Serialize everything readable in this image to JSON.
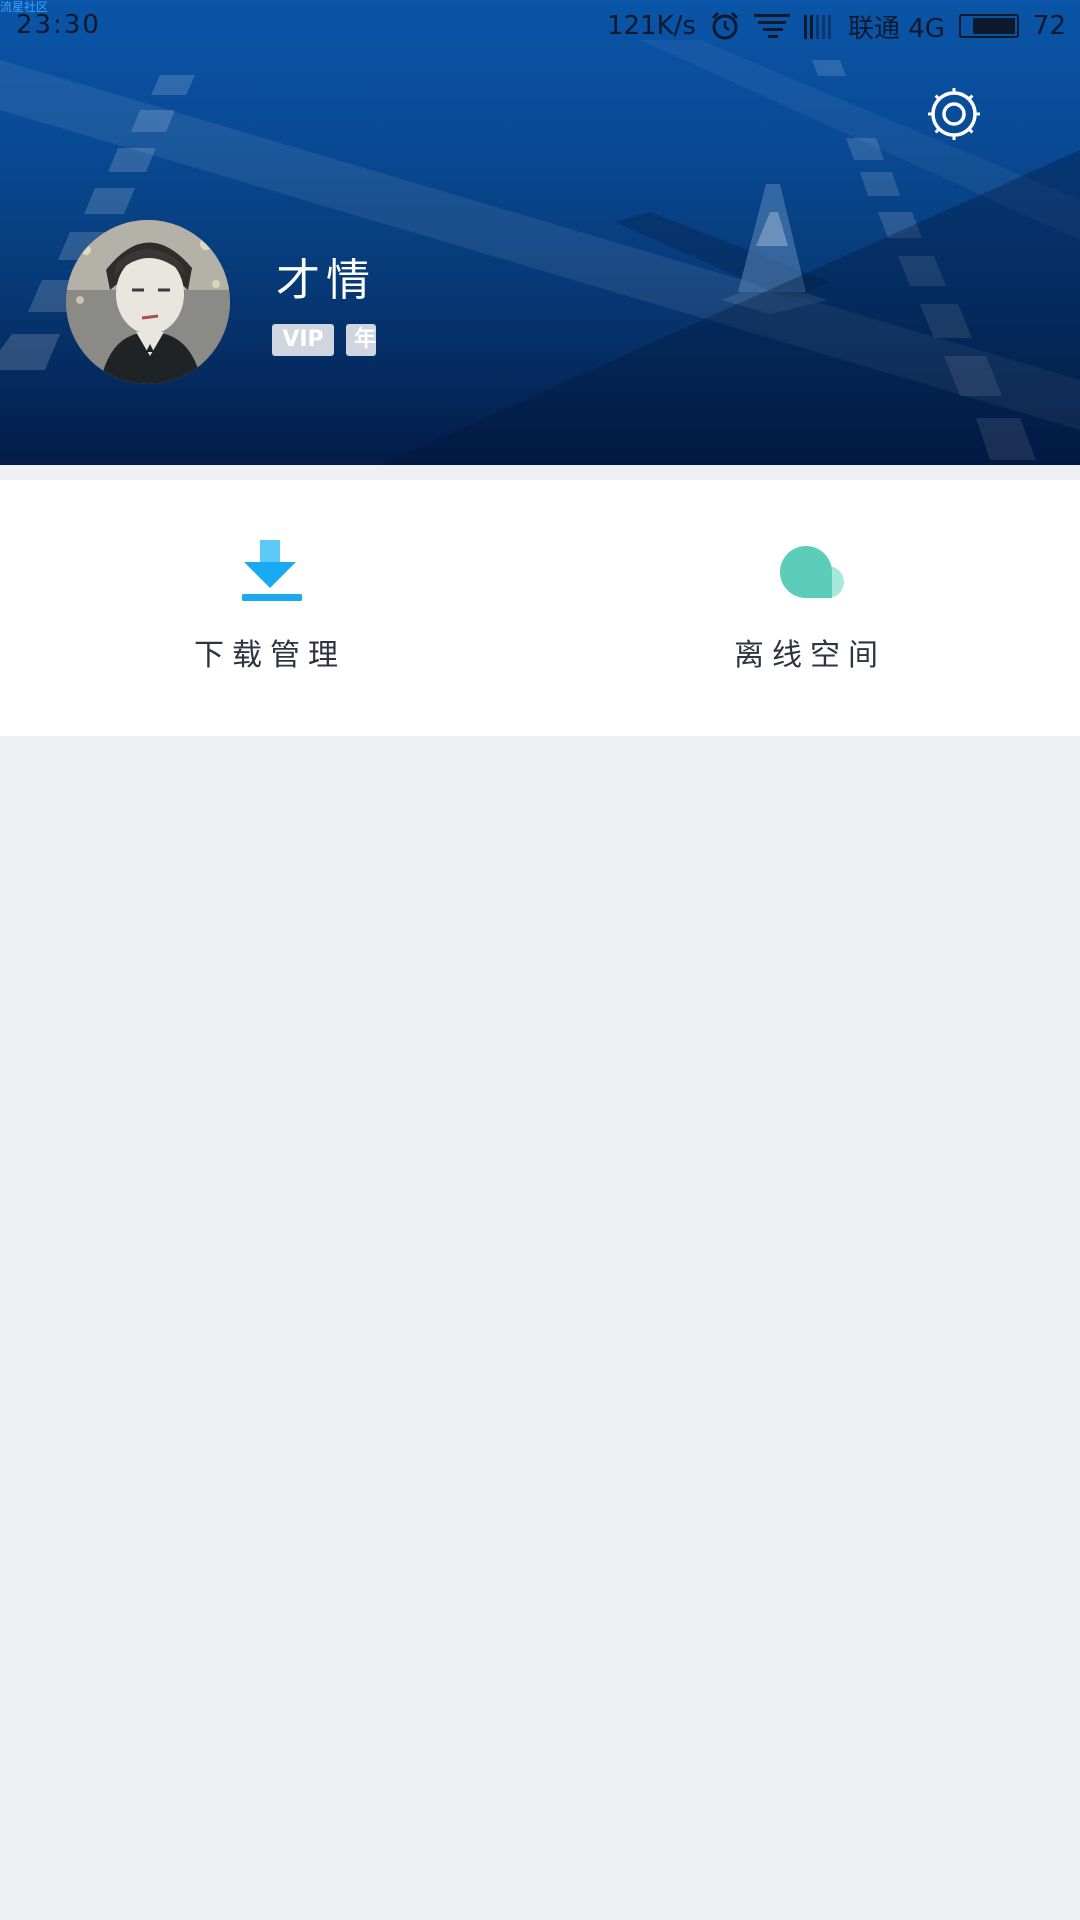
{
  "watermark": "流星社区",
  "status_bar": {
    "time": "23:30",
    "net_speed": "121K/s",
    "carrier": "联通 4G",
    "battery": "72",
    "battery_level": 0.72,
    "icons": [
      "alarm-icon",
      "wifi-icon",
      "signal-icon",
      "battery-icon"
    ]
  },
  "header": {
    "settings_icon": "settings-icon",
    "username": "才情",
    "badges": {
      "vip": "VIP",
      "year": "年"
    }
  },
  "actions": [
    {
      "label": "下载管理",
      "icon": "download-icon",
      "color": "#1aaaf2"
    },
    {
      "label": "离线空间",
      "icon": "cloud-icon",
      "color": "#5ccdb8"
    }
  ],
  "colors": {
    "header_top": "#0a55a8",
    "header_bottom": "#031b48",
    "page_background": "#eff0f2",
    "download_accent": "#1aaaf2",
    "cloud_accent": "#5ccdb8"
  }
}
